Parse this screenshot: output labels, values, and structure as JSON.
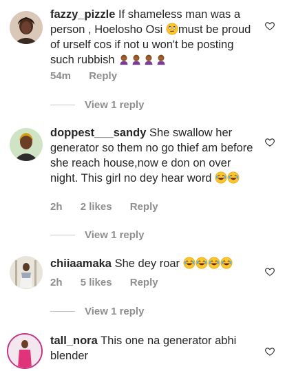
{
  "comments": [
    {
      "username": "fazzy_pizzle",
      "text_a": "If shameless man was a person , Hoelosho Osi ",
      "emoji_a": "eye-roll-emoji",
      "text_b": "must be proud of urself cos if not u won't be posting such rubbish ",
      "trailing_emojis": [
        "facepalm-emoji",
        "facepalm-emoji",
        "facepalm-emoji",
        "facepalm-emoji"
      ],
      "time": "54m",
      "likes": "",
      "reply_label": "Reply",
      "view_replies": "View 1 reply"
    },
    {
      "username": "doppest___sandy",
      "text_a": "She swallow her generator so them no go thief am before she reach house,now e don on over night. This girl no dey hear word ",
      "trailing_emojis": [
        "laughing-tears-emoji",
        "laughing-tears-emoji"
      ],
      "time": "2h",
      "likes": "2 likes",
      "reply_label": "Reply",
      "view_replies": "View 1 reply"
    },
    {
      "username": "chiiaamaka",
      "text_a": "She dey roar ",
      "trailing_emojis": [
        "laughing-tears-emoji",
        "laughing-tears-emoji",
        "laughing-tears-emoji",
        "laughing-tears-emoji"
      ],
      "time": "2h",
      "likes": "5 likes",
      "reply_label": "Reply",
      "view_replies": "View 1 reply"
    },
    {
      "username": "tall_nora",
      "text_a": "This one na generator abhi blender",
      "trailing_emojis": [],
      "time": "",
      "likes": "",
      "reply_label": "",
      "view_replies": ""
    }
  ],
  "colors": {
    "text": "#262626",
    "secondary": "#8e8e8e",
    "divider": "#c7c7c7"
  },
  "icons": {
    "like": "heart-outline-icon"
  }
}
